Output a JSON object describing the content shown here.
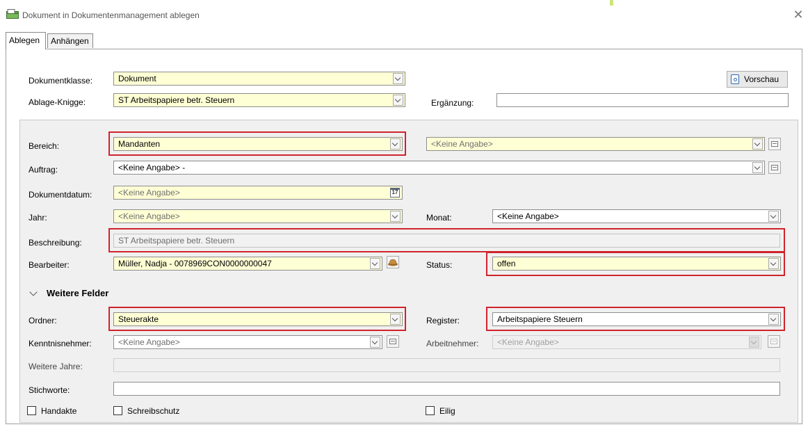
{
  "window": {
    "title": "Dokument in Dokumentenmanagement ablegen"
  },
  "tabs": [
    {
      "label": "Ablegen"
    },
    {
      "label": "Anhängen"
    }
  ],
  "top": {
    "dokumentklasse_label": "Dokumentklasse:",
    "dokumentklasse_value": "Dokument",
    "ablage_label": "Ablage-Knigge:",
    "ablage_value": "ST Arbeitspapiere betr. Steuern",
    "ergaenzung_label": "Ergänzung:",
    "ergaenzung_value": "",
    "vorschau_label": "Vorschau"
  },
  "form": {
    "bereich_label": "Bereich:",
    "bereich_value": "Mandanten",
    "bereich2_value": "<Keine Angabe>",
    "auftrag_label": "Auftrag:",
    "auftrag_value": "<Keine Angabe> -",
    "dokumentdatum_label": "Dokumentdatum:",
    "dokumentdatum_value": "<Keine Angabe>",
    "calendar_day": "17",
    "jahr_label": "Jahr:",
    "jahr_value": "<Keine Angabe>",
    "monat_label": "Monat:",
    "monat_value": "<Keine Angabe>",
    "beschreibung_label": "Beschreibung:",
    "beschreibung_value": "ST Arbeitspapiere betr. Steuern",
    "bearbeiter_label": "Bearbeiter:",
    "bearbeiter_value": "Müller, Nadja - 0078969CON0000000047",
    "status_label": "Status:",
    "status_value": "offen",
    "weitere_felder_label": "Weitere Felder",
    "ordner_label": "Ordner:",
    "ordner_value": "Steuerakte",
    "register_label": "Register:",
    "register_value": "Arbeitspapiere Steuern",
    "kenntnis_label": "Kenntnisnehmer:",
    "kenntnis_value": "<Keine Angabe>",
    "arbeitnehmer_label": "Arbeitnehmer:",
    "arbeitnehmer_value": "<Keine Angabe>",
    "weitere_jahre_label": "Weitere Jahre:",
    "weitere_jahre_value": "",
    "stichworte_label": "Stichworte:",
    "stichworte_value": ""
  },
  "checkboxes": [
    {
      "label": "Handakte",
      "checked": false
    },
    {
      "label": "Schreibschutz",
      "checked": false
    },
    {
      "label": "Eilig",
      "checked": false
    }
  ],
  "colors": {
    "highlight": "#d0232c",
    "field_yellow": "#ffffd5",
    "accent": "#cde67b"
  }
}
